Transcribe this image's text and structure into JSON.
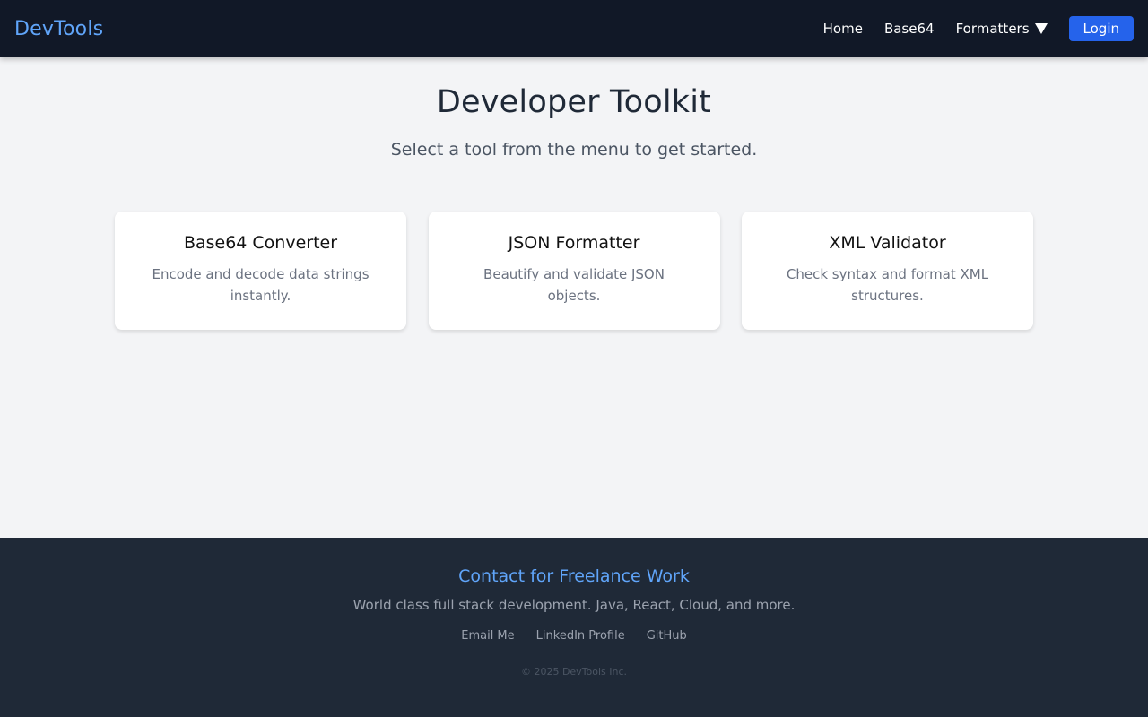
{
  "navbar": {
    "brand": "DevTools",
    "links": [
      {
        "label": "Home"
      },
      {
        "label": "Base64"
      },
      {
        "label": "Formatters",
        "icon": "caret-down-icon"
      }
    ],
    "login_label": "Login"
  },
  "main": {
    "title": "Developer Toolkit",
    "subtitle": "Select a tool from the menu to get started.",
    "cards": [
      {
        "title": "Base64 Converter",
        "description": "Encode and decode data strings instantly."
      },
      {
        "title": "JSON Formatter",
        "description": "Beautify and validate JSON objects."
      },
      {
        "title": "XML Validator",
        "description": "Check syntax and format XML structures."
      }
    ]
  },
  "footer": {
    "title": "Contact for Freelance Work",
    "tagline": "World class full stack development. Java, React, Cloud, and more.",
    "links": [
      {
        "label": "Email Me"
      },
      {
        "label": "LinkedIn Profile"
      },
      {
        "label": "GitHub"
      }
    ],
    "copyright": "© 2025 DevTools Inc."
  },
  "colors": {
    "navbar_bg": "#111827",
    "brand": "#60a5fa",
    "accent_button": "#2563eb",
    "page_bg": "#f3f4f6",
    "footer_bg": "#1f2937"
  }
}
